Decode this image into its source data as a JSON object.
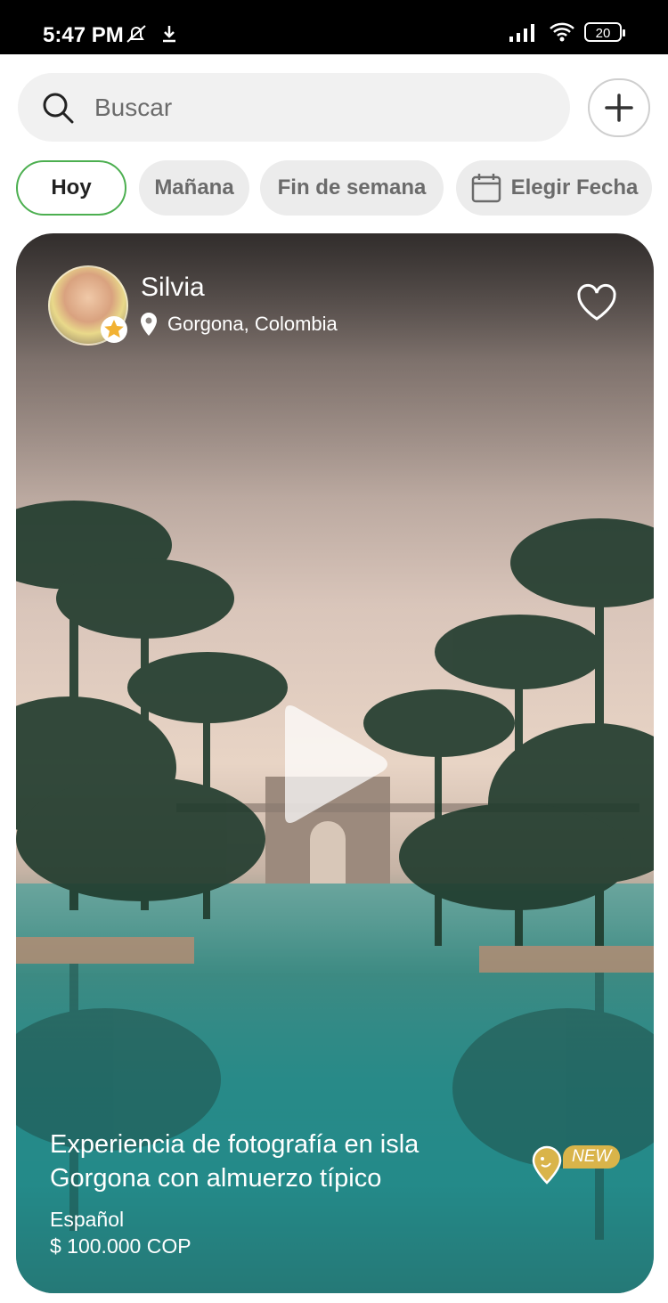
{
  "status_bar": {
    "time": "5:47 PM",
    "battery": "20"
  },
  "search": {
    "placeholder": "Buscar"
  },
  "filters": {
    "chips": [
      "Hoy",
      "Mañana",
      "Fin de semana",
      "Elegir Fecha"
    ],
    "active": "Hoy"
  },
  "card": {
    "host_name": "Silvia",
    "location": "Gorgona, Colombia",
    "title": "Experiencia de fotografía en isla Gorgona con almuerzo típico",
    "language": "Español",
    "price": "$ 100.000 COP",
    "badge": "NEW"
  },
  "colors": {
    "accent_green": "#4caf50",
    "badge_gold": "#d9b44a"
  }
}
